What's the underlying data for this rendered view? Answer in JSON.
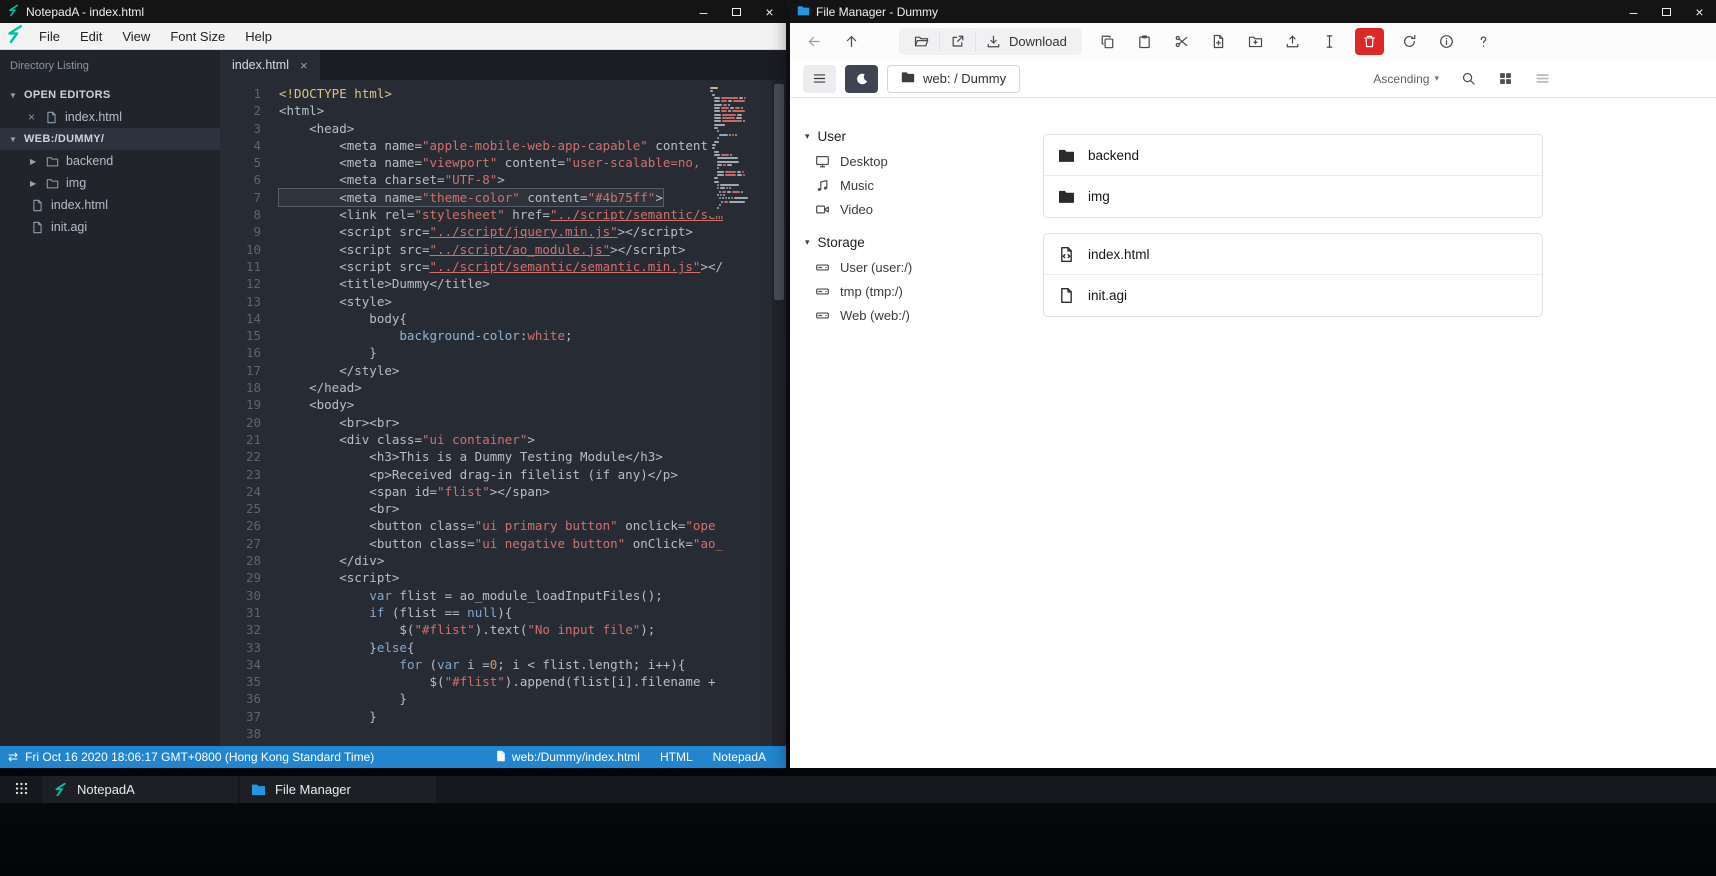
{
  "glyphs": {
    "minimize": "–",
    "close": "×",
    "sync": "⇄",
    "chevron_down": "▼",
    "chevron_right": "▶",
    "chevron_small": "▾",
    "tab_close": "×",
    "editor_close": "×"
  },
  "notepad": {
    "window_title": "NotepadA - index.html",
    "menu_items": [
      "File",
      "Edit",
      "View",
      "Font Size",
      "Help"
    ],
    "sidebar": {
      "header": "Directory Listing",
      "open_editors_label": "OPEN EDITORS",
      "open_editors": [
        "index.html"
      ],
      "workspace_label": "WEB:/DUMMY/",
      "tree": [
        {
          "name": "backend",
          "type": "folder"
        },
        {
          "name": "img",
          "type": "folder"
        },
        {
          "name": "index.html",
          "type": "file"
        },
        {
          "name": "init.agi",
          "type": "file"
        }
      ]
    },
    "active_tab": "index.html",
    "editor": {
      "active_line": 7,
      "lines": [
        [
          [
            "doc",
            "<!DOCTYPE html>"
          ]
        ],
        [
          [
            "pln",
            "<html>"
          ]
        ],
        [
          [
            "pln",
            "    <head>"
          ]
        ],
        [
          [
            "pln",
            "        <meta name="
          ],
          [
            "str",
            "\"apple-mobile-web-app-capable\""
          ],
          [
            "pln",
            " content="
          ],
          [
            "str",
            "\""
          ]
        ],
        [
          [
            "pln",
            "        <meta name="
          ],
          [
            "str",
            "\"viewport\""
          ],
          [
            "pln",
            " content="
          ],
          [
            "str",
            "\"user-scalable=no, wi"
          ]
        ],
        [
          [
            "pln",
            "        <meta charset="
          ],
          [
            "str",
            "\"UTF-8\""
          ],
          [
            "pln",
            ">"
          ]
        ],
        [
          [
            "pln",
            "        <meta name="
          ],
          [
            "str",
            "\"theme-color\""
          ],
          [
            "pln",
            " content="
          ],
          [
            "str",
            "\"#4b75ff\""
          ],
          [
            "pln",
            ">"
          ]
        ],
        [
          [
            "pln",
            "        <link rel="
          ],
          [
            "str",
            "\"stylesheet\""
          ],
          [
            "pln",
            " href="
          ],
          [
            "lstr",
            "\"../script/semantic/sem"
          ]
        ],
        [
          [
            "pln",
            "        <script src="
          ],
          [
            "lstr",
            "\"../script/jquery.min.js\""
          ],
          [
            "pln",
            "></script>"
          ]
        ],
        [
          [
            "pln",
            "        <script src="
          ],
          [
            "lstr",
            "\"../script/ao_module.js\""
          ],
          [
            "pln",
            "></script>"
          ]
        ],
        [
          [
            "pln",
            "        <script src="
          ],
          [
            "lstr",
            "\"../script/semantic/semantic.min.js\""
          ],
          [
            "pln",
            "></"
          ]
        ],
        [
          [
            "pln",
            "        <title>Dummy</title>"
          ]
        ],
        [
          [
            "pln",
            "        <style>"
          ]
        ],
        [
          [
            "pln",
            "            body{"
          ]
        ],
        [
          [
            "prop",
            "                background-color"
          ],
          [
            "pln",
            ":"
          ],
          [
            "str",
            "white"
          ],
          [
            "pln",
            ";"
          ]
        ],
        [
          [
            "pln",
            "            }"
          ]
        ],
        [
          [
            "pln",
            "        </style>"
          ]
        ],
        [
          [
            "pln",
            "    </head>"
          ]
        ],
        [
          [
            "pln",
            "    <body>"
          ]
        ],
        [
          [
            "pln",
            "        <br><br>"
          ]
        ],
        [
          [
            "pln",
            "        <div class="
          ],
          [
            "str",
            "\"ui container\""
          ],
          [
            "pln",
            ">"
          ]
        ],
        [
          [
            "pln",
            "            <h3>This is a Dummy Testing Module</h3>"
          ]
        ],
        [
          [
            "pln",
            "            <p>Received drag-in filelist (if any)</p>"
          ]
        ],
        [
          [
            "pln",
            "            <span id="
          ],
          [
            "str",
            "\"flist\""
          ],
          [
            "pln",
            "></span>"
          ]
        ],
        [
          [
            "pln",
            "            <br>"
          ]
        ],
        [
          [
            "pln",
            "            <button class="
          ],
          [
            "str",
            "\"ui primary button\""
          ],
          [
            "pln",
            " onclick="
          ],
          [
            "str",
            "\"ope"
          ]
        ],
        [
          [
            "pln",
            "            <button class="
          ],
          [
            "str",
            "\"ui negative button\""
          ],
          [
            "pln",
            " onClick="
          ],
          [
            "str",
            "\"ao_"
          ]
        ],
        [
          [
            "pln",
            "        </div>"
          ]
        ],
        [
          [
            "pln",
            "        <script>"
          ]
        ],
        [
          [
            "pln",
            "            "
          ],
          [
            "kw",
            "var"
          ],
          [
            "pln",
            " flist = ao_module_loadInputFiles();"
          ]
        ],
        [
          [
            "pln",
            "            "
          ],
          [
            "kw",
            "if"
          ],
          [
            "pln",
            " (flist == "
          ],
          [
            "kw",
            "null"
          ],
          [
            "pln",
            "){"
          ]
        ],
        [
          [
            "pln",
            "                $("
          ],
          [
            "str",
            "\"#flist\""
          ],
          [
            "pln",
            ").text("
          ],
          [
            "str",
            "\"No input file\""
          ],
          [
            "pln",
            ");"
          ]
        ],
        [
          [
            "pln",
            "            }"
          ],
          [
            "kw",
            "else"
          ],
          [
            "pln",
            "{"
          ]
        ],
        [
          [
            "pln",
            "                "
          ],
          [
            "kw",
            "for"
          ],
          [
            "pln",
            " ("
          ],
          [
            "kw",
            "var"
          ],
          [
            "pln",
            " i ="
          ],
          [
            "num",
            "0"
          ],
          [
            "pln",
            "; i < flist.length; i++){"
          ]
        ],
        [
          [
            "pln",
            "                    $("
          ],
          [
            "str",
            "\"#flist\""
          ],
          [
            "pln",
            ").append(flist[i].filename + "
          ]
        ],
        [
          [
            "pln",
            "                }"
          ]
        ],
        [
          [
            "pln",
            "            }"
          ]
        ],
        [
          [
            "pln",
            ""
          ]
        ]
      ]
    },
    "statusbar": {
      "datetime": "Fri Oct 16 2020 18:06:17 GMT+0800 (Hong Kong Standard Time)",
      "file_path": "web:/Dummy/index.html",
      "language": "HTML",
      "app_name": "NotepadA"
    }
  },
  "filemanager": {
    "window_title": "File Manager - Dummy",
    "toolbar_buttons": [
      {
        "name": "back",
        "icon": "arrow-left",
        "style": "plain"
      },
      {
        "name": "up",
        "icon": "arrow-up",
        "style": "plain"
      },
      {
        "name": "open",
        "icon": "folder-open",
        "style": "group"
      },
      {
        "name": "open-external",
        "icon": "external-link",
        "style": "group"
      },
      {
        "name": "download",
        "icon": "download",
        "style": "group",
        "label": "Download"
      },
      {
        "name": "copy",
        "icon": "copy",
        "style": "flat"
      },
      {
        "name": "paste",
        "icon": "paste",
        "style": "flat"
      },
      {
        "name": "cut",
        "icon": "scissors",
        "style": "flat"
      },
      {
        "name": "new-file",
        "icon": "file-new",
        "style": "flat"
      },
      {
        "name": "new-folder",
        "icon": "folder-new",
        "style": "flat"
      },
      {
        "name": "upload",
        "icon": "upload",
        "style": "flat"
      },
      {
        "name": "rename",
        "icon": "text-cursor",
        "style": "flat"
      },
      {
        "name": "delete",
        "icon": "trash",
        "style": "danger"
      },
      {
        "name": "refresh",
        "icon": "refresh",
        "style": "flat"
      },
      {
        "name": "info",
        "icon": "info",
        "style": "flat"
      },
      {
        "name": "help",
        "icon": "question",
        "style": "flat"
      }
    ],
    "breadcrumb": "web: / Dummy",
    "sort_order": "Ascending",
    "sidebar_sections": [
      {
        "label": "User",
        "items": [
          {
            "label": "Desktop",
            "icon": "desktop"
          },
          {
            "label": "Music",
            "icon": "music"
          },
          {
            "label": "Video",
            "icon": "video"
          }
        ]
      },
      {
        "label": "Storage",
        "items": [
          {
            "label": "User (user:/)",
            "icon": "drive"
          },
          {
            "label": "tmp (tmp:/)",
            "icon": "drive"
          },
          {
            "label": "Web (web:/)",
            "icon": "drive"
          }
        ]
      }
    ],
    "file_groups": [
      {
        "items": [
          {
            "name": "backend",
            "icon": "folder-fill"
          },
          {
            "name": "img",
            "icon": "folder-fill"
          }
        ]
      },
      {
        "items": [
          {
            "name": "index.html",
            "icon": "file-code"
          },
          {
            "name": "init.agi",
            "icon": "file"
          }
        ]
      }
    ]
  },
  "taskbar": {
    "items": [
      {
        "label": "NotepadA",
        "icon": "notepada-logo"
      },
      {
        "label": "File Manager",
        "icon": "folder-blue"
      }
    ]
  },
  "colors": {
    "statusbar_blue": "#2185d0",
    "delete_red": "#db2828",
    "logo_teal": "#00c2a8",
    "folder_blue": "#2796e0"
  }
}
